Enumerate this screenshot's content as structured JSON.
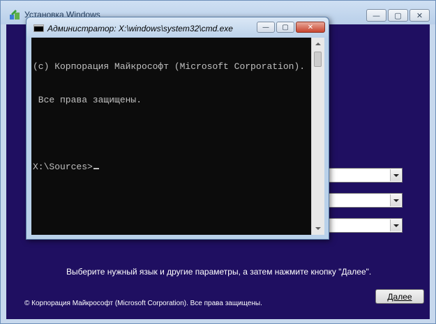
{
  "setup_window": {
    "title": "Установка Windows",
    "minimize_glyph": "—",
    "maximize_glyph": "▢",
    "close_glyph": "✕",
    "instruction": "Выберите нужный язык и другие параметры, а затем нажмите кнопку \"Далее\".",
    "copyright": "© Корпорация Майкрософт (Microsoft Corporation). Все права защищены.",
    "next_button": "Далее",
    "dropdowns": [
      "",
      "",
      ""
    ]
  },
  "cmd_window": {
    "title": "Администратор: X:\\windows\\system32\\cmd.exe",
    "minimize_glyph": "—",
    "maximize_glyph": "▢",
    "close_glyph": "✕",
    "lines": [
      "(c) Корпорация Майкрософт (Microsoft Corporation).",
      " Все права защищены.",
      "",
      "X:\\Sources>"
    ]
  },
  "colors": {
    "setup_background": "#1f0f61",
    "console_background": "#0c0c0c",
    "console_text": "#c0c0c0"
  },
  "icons": {
    "setup_app": "setup-icon",
    "cmd_app": "cmd-icon"
  }
}
